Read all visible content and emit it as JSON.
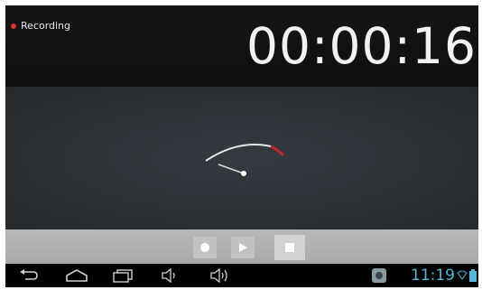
{
  "header": {
    "recording_label": "Recording",
    "timer": "00:00:16"
  },
  "controls": {
    "record_icon": "record-icon",
    "play_icon": "play-icon",
    "stop_icon": "stop-icon"
  },
  "navbar": {
    "clock": "11:19",
    "icons": [
      "back-icon",
      "home-icon",
      "recent-apps-icon",
      "volume-down-icon",
      "volume-up-icon",
      "app-notification-icon",
      "wifi-icon",
      "battery-icon"
    ]
  },
  "colors": {
    "recording_dot": "#d9312b",
    "clock": "#58b7d6",
    "meter_peak": "#c0272d"
  }
}
